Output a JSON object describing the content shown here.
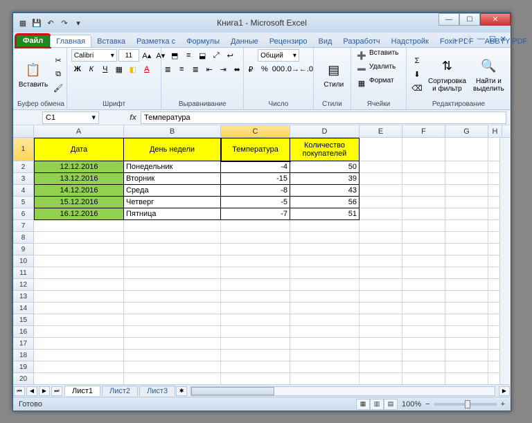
{
  "title": "Книга1  -  Microsoft Excel",
  "tabs": {
    "file": "Файл",
    "items": [
      "Главная",
      "Вставка",
      "Разметка с",
      "Формулы",
      "Данные",
      "Рецензиро",
      "Вид",
      "Разработч",
      "Надстройк",
      "Foxit PDF",
      "ABBYY PDF"
    ],
    "active_index": 0
  },
  "ribbon": {
    "clipboard": {
      "paste": "Вставить",
      "label": "Буфер обмена"
    },
    "font": {
      "name": "Calibri",
      "size": "11",
      "label": "Шрифт"
    },
    "align": {
      "label": "Выравнивание"
    },
    "number": {
      "format": "Общий",
      "label": "Число"
    },
    "styles": {
      "btn": "Стили",
      "label": "Стили"
    },
    "cells": {
      "insert": "Вставить",
      "delete": "Удалить",
      "format": "Формат",
      "label": "Ячейки"
    },
    "edit": {
      "sort": "Сортировка\nи фильтр",
      "find": "Найти и\nвыделить",
      "label": "Редактирование"
    }
  },
  "namebox": "C1",
  "formula": "Температура",
  "columns": [
    {
      "letter": "A",
      "w": 130
    },
    {
      "letter": "B",
      "w": 140
    },
    {
      "letter": "C",
      "w": 100
    },
    {
      "letter": "D",
      "w": 100
    },
    {
      "letter": "E",
      "w": 62
    },
    {
      "letter": "F",
      "w": 62
    },
    {
      "letter": "G",
      "w": 62
    },
    {
      "letter": "H",
      "w": 20
    }
  ],
  "sel_col": 2,
  "sel_row": 0,
  "headers": {
    "a": "Дата",
    "b": "День недели",
    "c": "Температура",
    "d_line1": "Количество",
    "d_line2": "покупателей"
  },
  "rows": [
    {
      "date": "12.12.2016",
      "day": "Понедельник",
      "temp": "-4",
      "buyers": "50"
    },
    {
      "date": "13.12.2016",
      "day": "Вторник",
      "temp": "-15",
      "buyers": "39"
    },
    {
      "date": "14.12.2016",
      "day": "Среда",
      "temp": "-8",
      "buyers": "43"
    },
    {
      "date": "15.12.2016",
      "day": "Четверг",
      "temp": "-5",
      "buyers": "56"
    },
    {
      "date": "16.12.2016",
      "day": "Пятница",
      "temp": "-7",
      "buyers": "51"
    }
  ],
  "total_rows": 20,
  "sheets": [
    "Лист1",
    "Лист2",
    "Лист3"
  ],
  "active_sheet": 0,
  "status": {
    "ready": "Готово",
    "zoom": "100%"
  },
  "chart_data": {
    "type": "table",
    "columns": [
      "Дата",
      "День недели",
      "Температура",
      "Количество покупателей"
    ],
    "data": [
      [
        "12.12.2016",
        "Понедельник",
        -4,
        50
      ],
      [
        "13.12.2016",
        "Вторник",
        -15,
        39
      ],
      [
        "14.12.2016",
        "Среда",
        -8,
        43
      ],
      [
        "15.12.2016",
        "Четверг",
        -5,
        56
      ],
      [
        "16.12.2016",
        "Пятница",
        -7,
        51
      ]
    ]
  }
}
